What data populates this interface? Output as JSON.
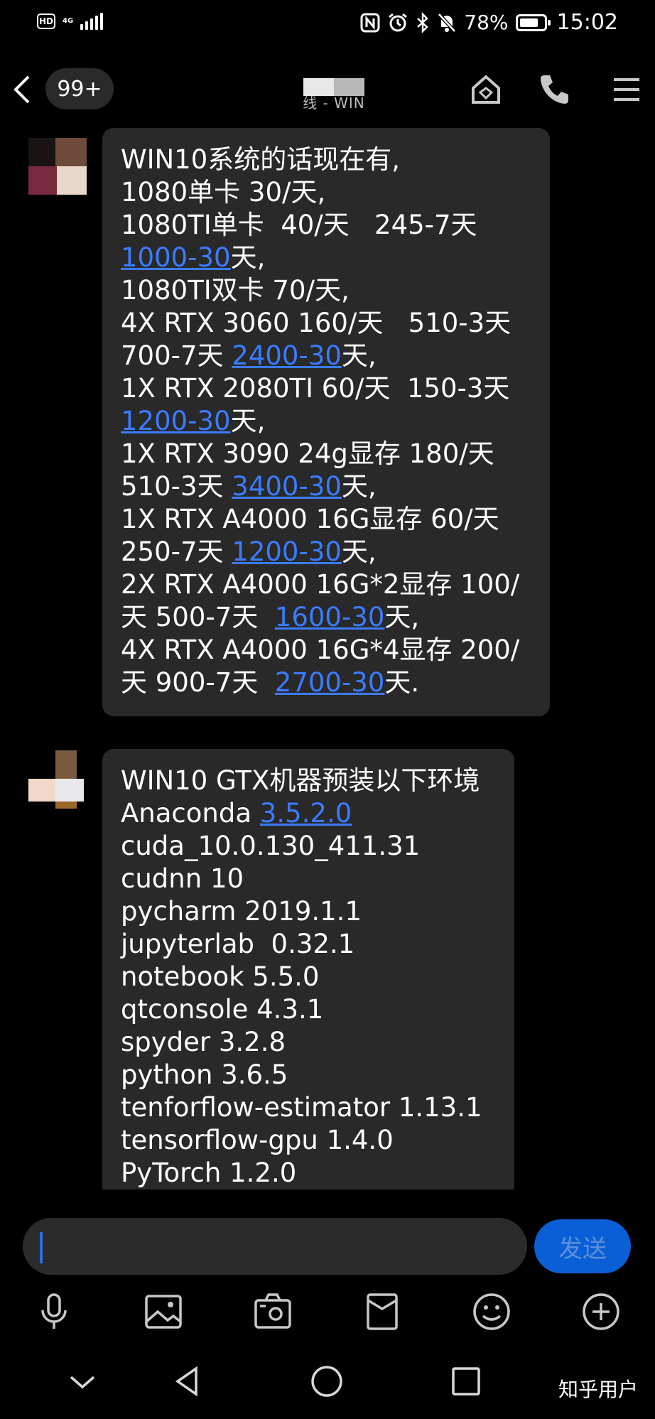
{
  "status_bar": {
    "hd": "HD",
    "network": "4G",
    "battery_text": "78%",
    "battery_level": 0.78,
    "time": "15:02"
  },
  "header": {
    "unread_count": "99+",
    "subtitle": "线 - WIN"
  },
  "messages": [
    {
      "lines": [
        [
          {
            "t": "WIN10系统的话现在有,"
          }
        ],
        [
          {
            "t": "1080单卡 30/天,"
          }
        ],
        [
          {
            "t": "1080TI单卡  40/天   245-7天"
          }
        ],
        [
          {
            "t": "1000-30",
            "link": true
          },
          {
            "t": "天,"
          }
        ],
        [
          {
            "t": "1080TI双卡 70/天,"
          }
        ],
        [
          {
            "t": "4X RTX 3060 160/天   510-3天"
          }
        ],
        [
          {
            "t": "700-7天 "
          },
          {
            "t": "2400-30",
            "link": true
          },
          {
            "t": "天,"
          }
        ],
        [
          {
            "t": "1X RTX 2080TI 60/天  150-3天"
          }
        ],
        [
          {
            "t": "1200-30",
            "link": true
          },
          {
            "t": "天,"
          }
        ],
        [
          {
            "t": "1X RTX 3090 24g显存 180/天"
          }
        ],
        [
          {
            "t": "510-3天 "
          },
          {
            "t": "3400-30",
            "link": true
          },
          {
            "t": "天,"
          }
        ],
        [
          {
            "t": "1X RTX A4000 16G显存 60/天"
          }
        ],
        [
          {
            "t": "250-7天 "
          },
          {
            "t": "1200-30",
            "link": true
          },
          {
            "t": "天,"
          }
        ],
        [
          {
            "t": "2X RTX A4000 16G*2显存 100/"
          }
        ],
        [
          {
            "t": "天 500-7天  "
          },
          {
            "t": "1600-30",
            "link": true
          },
          {
            "t": "天,"
          }
        ],
        [
          {
            "t": "4X RTX A4000 16G*4显存 200/"
          }
        ],
        [
          {
            "t": "天 900-7天  "
          },
          {
            "t": "2700-30",
            "link": true
          },
          {
            "t": "天."
          }
        ]
      ]
    },
    {
      "lines": [
        [
          {
            "t": "WIN10 GTX机器预装以下环境"
          }
        ],
        [
          {
            "t": "Anaconda "
          },
          {
            "t": "3.5.2.0",
            "link": true
          }
        ],
        [
          {
            "t": "cuda_10.0.130_411.31"
          }
        ],
        [
          {
            "t": "cudnn 10"
          }
        ],
        [
          {
            "t": "pycharm 2019.1.1"
          }
        ],
        [
          {
            "t": "jupyterlab  0.32.1"
          }
        ],
        [
          {
            "t": "notebook 5.5.0"
          }
        ],
        [
          {
            "t": "qtconsole 4.3.1"
          }
        ],
        [
          {
            "t": "spyder 3.2.8"
          }
        ],
        [
          {
            "t": "python 3.6.5"
          }
        ],
        [
          {
            "t": "tenforflow-estimator 1.13.1"
          }
        ],
        [
          {
            "t": "tensorflow-gpu 1.4.0"
          }
        ],
        [
          {
            "t": "PyTorch 1.2.0"
          }
        ]
      ]
    }
  ],
  "input": {
    "value": "",
    "send_label": "发送"
  },
  "toolbar": {
    "icons": [
      "microphone-icon",
      "image-icon",
      "camera-icon",
      "folder-icon",
      "emoji-icon",
      "plus-icon"
    ]
  },
  "nav": {
    "icons": [
      "chevron-down-icon",
      "back-triangle-icon",
      "home-circle-icon",
      "recents-square-icon"
    ]
  },
  "watermark": "知乎用户",
  "colors": {
    "background": "#000000",
    "bubble": "#292929",
    "link": "#3a7bff",
    "send_button": "#0a5fd6"
  }
}
